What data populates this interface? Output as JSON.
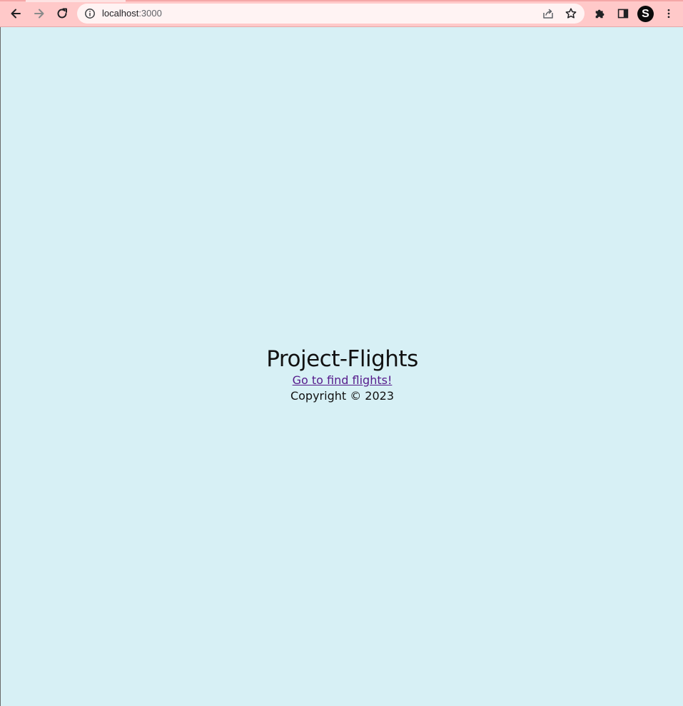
{
  "browser": {
    "url_host": "localhost",
    "url_port": ":3000",
    "profile_initial": "S"
  },
  "page": {
    "title": "Project-Flights",
    "link_text": "Go to find flights!",
    "copyright": "Copyright © 2023"
  },
  "colors": {
    "toolbar_bg": "#ffc9c9",
    "page_bg": "#d7f0f5",
    "visited_link": "#551a8b"
  },
  "icons": [
    "back-arrow-icon",
    "forward-arrow-icon",
    "reload-icon",
    "info-icon",
    "share-icon",
    "star-icon",
    "extensions-puzzle-icon",
    "side-panel-icon",
    "kebab-menu-icon"
  ]
}
